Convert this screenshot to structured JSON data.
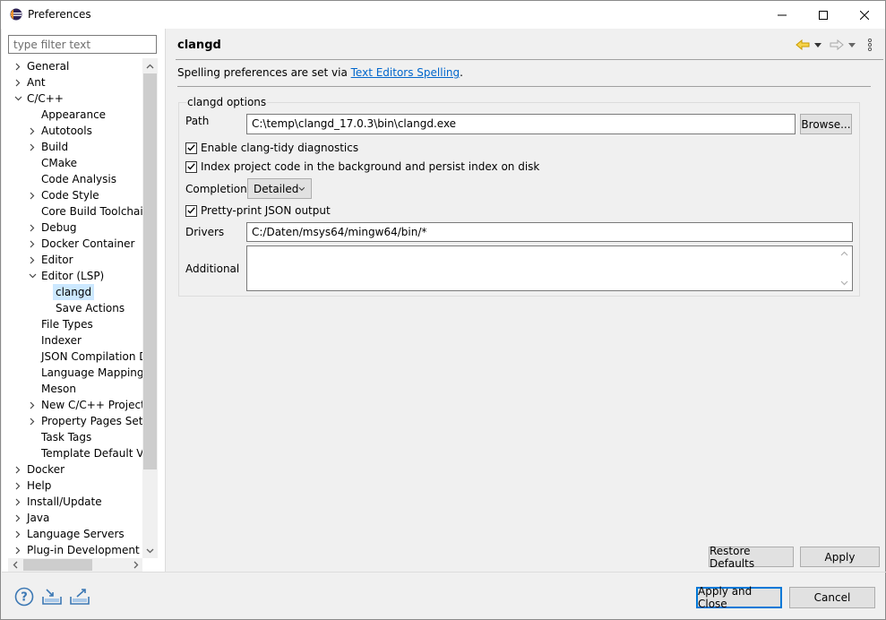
{
  "window": {
    "title": "Preferences"
  },
  "left": {
    "filter_placeholder": "type filter text",
    "tree": [
      {
        "label": "General",
        "level": 0,
        "twisty": "collapsed"
      },
      {
        "label": "Ant",
        "level": 0,
        "twisty": "collapsed"
      },
      {
        "label": "C/C++",
        "level": 0,
        "twisty": "expanded"
      },
      {
        "label": "Appearance",
        "level": 1,
        "twisty": "none"
      },
      {
        "label": "Autotools",
        "level": 1,
        "twisty": "collapsed"
      },
      {
        "label": "Build",
        "level": 1,
        "twisty": "collapsed"
      },
      {
        "label": "CMake",
        "level": 1,
        "twisty": "none"
      },
      {
        "label": "Code Analysis",
        "level": 1,
        "twisty": "none"
      },
      {
        "label": "Code Style",
        "level": 1,
        "twisty": "collapsed"
      },
      {
        "label": "Core Build Toolchains",
        "level": 1,
        "twisty": "none"
      },
      {
        "label": "Debug",
        "level": 1,
        "twisty": "collapsed"
      },
      {
        "label": "Docker Container",
        "level": 1,
        "twisty": "collapsed"
      },
      {
        "label": "Editor",
        "level": 1,
        "twisty": "collapsed"
      },
      {
        "label": "Editor (LSP)",
        "level": 1,
        "twisty": "expanded"
      },
      {
        "label": "clangd",
        "level": 2,
        "twisty": "none",
        "selected": true
      },
      {
        "label": "Save Actions",
        "level": 2,
        "twisty": "none"
      },
      {
        "label": "File Types",
        "level": 1,
        "twisty": "none"
      },
      {
        "label": "Indexer",
        "level": 1,
        "twisty": "none"
      },
      {
        "label": "JSON Compilation Da",
        "level": 1,
        "twisty": "none"
      },
      {
        "label": "Language Mappings",
        "level": 1,
        "twisty": "none"
      },
      {
        "label": "Meson",
        "level": 1,
        "twisty": "none"
      },
      {
        "label": "New C/C++ Project W",
        "level": 1,
        "twisty": "collapsed"
      },
      {
        "label": "Property Pages Settin",
        "level": 1,
        "twisty": "collapsed"
      },
      {
        "label": "Task Tags",
        "level": 1,
        "twisty": "none"
      },
      {
        "label": "Template Default Valu",
        "level": 1,
        "twisty": "none"
      },
      {
        "label": "Docker",
        "level": 0,
        "twisty": "collapsed"
      },
      {
        "label": "Help",
        "level": 0,
        "twisty": "collapsed"
      },
      {
        "label": "Install/Update",
        "level": 0,
        "twisty": "collapsed"
      },
      {
        "label": "Java",
        "level": 0,
        "twisty": "collapsed"
      },
      {
        "label": "Language Servers",
        "level": 0,
        "twisty": "collapsed"
      },
      {
        "label": "Plug-in Development",
        "level": 0,
        "twisty": "collapsed"
      }
    ]
  },
  "page": {
    "title": "clangd",
    "spelling_prefix": "Spelling preferences are set via ",
    "spelling_link": "Text Editors Spelling",
    "spelling_suffix": ".",
    "group_title": "clangd options",
    "path_label": "Path",
    "path_value": "C:\\temp\\clangd_17.0.3\\bin\\clangd.exe",
    "browse_label": "Browse...",
    "check_clang_tidy": "Enable clang-tidy diagnostics",
    "check_index": "Index project code in the background and persist index on disk",
    "completion_label": "Completion",
    "completion_value": "Detailed",
    "check_pretty": "Pretty-print JSON output",
    "drivers_label": "Drivers",
    "drivers_value": "C:/Daten/msys64/mingw64/bin/*",
    "additional_label": "Additional",
    "additional_value": ""
  },
  "buttons": {
    "restore_defaults": "Restore Defaults",
    "apply": "Apply",
    "apply_close": "Apply and Close",
    "cancel": "Cancel"
  },
  "colors": {
    "selection": "#cce8ff",
    "link": "#0066cc",
    "default_button_border": "#0078d7",
    "nav_back": "#e8b400",
    "bottom_icon": "#3c78b4"
  }
}
